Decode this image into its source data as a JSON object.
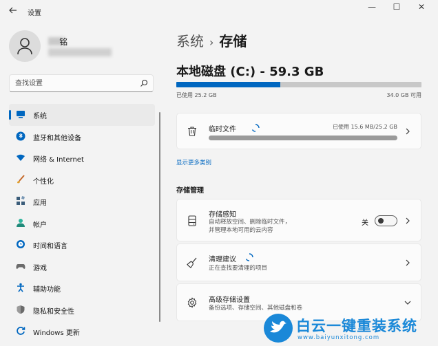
{
  "window": {
    "title": "设置",
    "back_icon": "back-arrow-icon",
    "controls": {
      "minimize": "—",
      "maximize": "☐",
      "close": "✕"
    }
  },
  "user": {
    "name": "铭",
    "avatar_icon": "person-icon"
  },
  "search": {
    "placeholder": "查找设置",
    "icon": "search-icon"
  },
  "sidebar": {
    "items": [
      {
        "label": "系统",
        "icon": "system-icon",
        "color": "#0067c0",
        "active": true
      },
      {
        "label": "蓝牙和其他设备",
        "icon": "bluetooth-icon",
        "color": "#0067c0",
        "active": false
      },
      {
        "label": "网络 & Internet",
        "icon": "wifi-icon",
        "color": "#0067c0",
        "active": false
      },
      {
        "label": "个性化",
        "icon": "brush-icon",
        "color": "#c56a2c",
        "active": false
      },
      {
        "label": "应用",
        "icon": "apps-icon",
        "color": "#3b5d7a",
        "active": false
      },
      {
        "label": "帐户",
        "icon": "account-icon",
        "color": "#2bb39b",
        "active": false
      },
      {
        "label": "时间和语言",
        "icon": "globe-clock-icon",
        "color": "#0067c0",
        "active": false
      },
      {
        "label": "游戏",
        "icon": "gamepad-icon",
        "color": "#6b6b6b",
        "active": false
      },
      {
        "label": "辅助功能",
        "icon": "accessibility-icon",
        "color": "#0067c0",
        "active": false
      },
      {
        "label": "隐私和安全性",
        "icon": "shield-icon",
        "color": "#6b6b6b",
        "active": false
      },
      {
        "label": "Windows 更新",
        "icon": "windows-update-icon",
        "color": "#0067c0",
        "active": false
      }
    ]
  },
  "main": {
    "breadcrumb": {
      "parent": "系统",
      "separator": "›",
      "current": "存储"
    },
    "disk": {
      "title": "本地磁盘 (C:) - 59.3 GB",
      "used_text": "已使用 25.2 GB",
      "free_text": "34.0 GB 可用",
      "used_fraction": 0.425
    },
    "temp_files": {
      "title": "临时文件",
      "used_text": "已使用 15.6 MB/25.2 GB",
      "icon": "trash-icon",
      "bar_fraction": 1.0
    },
    "show_more_link": "显示更多类别",
    "storage_management": {
      "section_title": "存储管理",
      "storage_sense": {
        "title": "存储感知",
        "desc_line1": "自动释放空间、删除临时文件，",
        "desc_line2": "并管理本地可用的云内容",
        "toggle_label": "关",
        "toggle_on": false,
        "icon": "storage-drive-icon"
      },
      "cleanup": {
        "title": "清理建议",
        "desc": "正在查找要清理的项目",
        "icon": "broom-icon"
      },
      "advanced": {
        "title": "高级存储设置",
        "desc": "备份选项、存储空间、其他磁盘和卷",
        "icon": "gear-icon"
      }
    }
  },
  "watermark": {
    "text": "白云一键重装系统",
    "url_text": "www.baiyunxitong.com"
  },
  "colors": {
    "accent": "#0067c0",
    "background": "#f3f3f3",
    "card": "#fbfbfb"
  }
}
